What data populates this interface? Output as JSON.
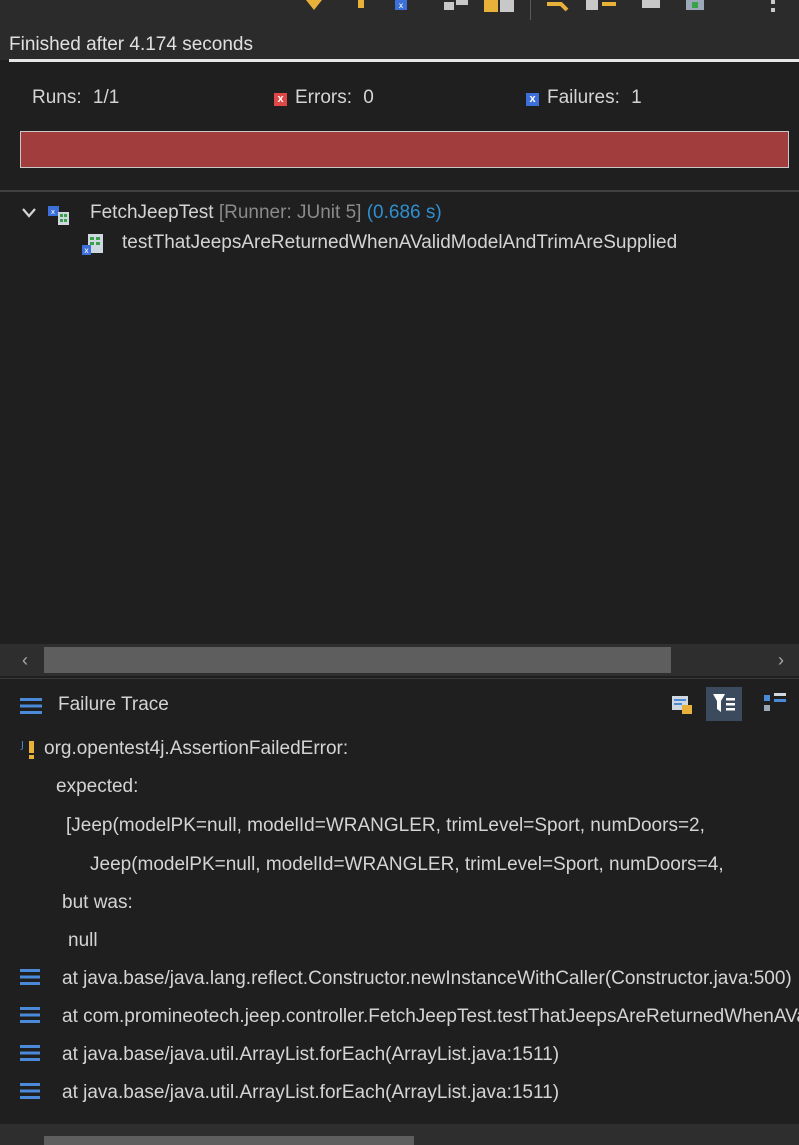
{
  "status": {
    "finished_text": "Finished after 4.174 seconds"
  },
  "counters": {
    "runs_label": "Runs:",
    "runs_value": "1/1",
    "errors_label": "Errors:",
    "errors_value": "0",
    "failures_label": "Failures:",
    "failures_value": "1"
  },
  "progress": {
    "fraction": 1.0,
    "color": "#a23d3d"
  },
  "tree": {
    "suite_name": "FetchJeepTest",
    "suite_runner": "[Runner: JUnit 5]",
    "suite_time": "(0.686 s)",
    "test_case": "testThatJeepsAreReturnedWhenAValidModelAndTrimAreSupplied"
  },
  "failure_trace": {
    "title": "Failure Trace",
    "lines": [
      "org.opentest4j.AssertionFailedError:",
      "expected:",
      "[Jeep(modelPK=null, modelId=WRANGLER, trimLevel=Sport, numDoors=2,",
      "Jeep(modelPK=null, modelId=WRANGLER, trimLevel=Sport, numDoors=4,",
      "but was:",
      "null",
      "at java.base/java.lang.reflect.Constructor.newInstanceWithCaller(Constructor.java:500)",
      "at com.promineotech.jeep.controller.FetchJeepTest.testThatJeepsAreReturnedWhenAValidModelAndTrimAreSupplied",
      "at java.base/java.util.ArrayList.forEach(ArrayList.java:1511)",
      "at java.base/java.util.ArrayList.forEach(ArrayList.java:1511)"
    ]
  },
  "icons": {
    "suite": "junit-suite-icon",
    "test_case": "junit-test-failed-icon",
    "trace_header": "list-icon",
    "exception": "exception-warning-icon",
    "stack_frame": "stack-frame-icon",
    "compare": "compare-results-icon",
    "filter": "filter-stack-icon",
    "copy": "copy-trace-icon"
  }
}
